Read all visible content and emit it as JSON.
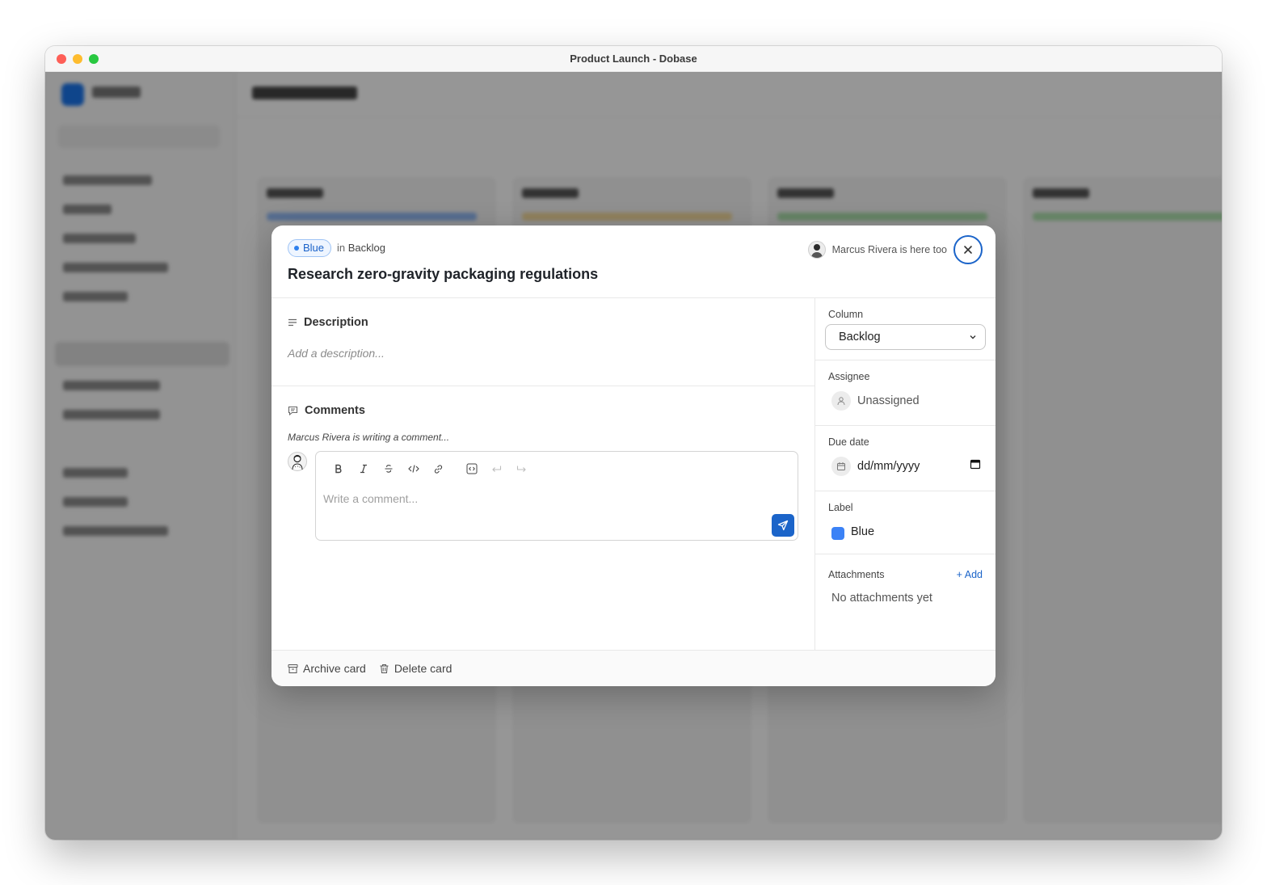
{
  "window": {
    "title": "Product Launch - Dobase"
  },
  "card": {
    "label_badge": "Blue",
    "in_prefix": "in",
    "column_name": "Backlog",
    "title": "Research zero-gravity packaging regulations",
    "presence": "Marcus Rivera is here too"
  },
  "description": {
    "heading": "Description",
    "placeholder": "Add a description..."
  },
  "comments": {
    "heading": "Comments",
    "typing_indicator": "Marcus Rivera is writing a comment...",
    "placeholder": "Write a comment...",
    "toolbar": [
      "bold-icon",
      "italic-icon",
      "strikethrough-icon",
      "code-icon",
      "link-icon",
      "code-block-icon",
      "undo-icon",
      "redo-icon"
    ]
  },
  "sidebar_fields": {
    "column_label": "Column",
    "column_value": "Backlog",
    "assignee_label": "Assignee",
    "assignee_value": "Unassigned",
    "due_label": "Due date",
    "due_value": "dd/mm/yyyy",
    "label_label": "Label",
    "label_value": "Blue",
    "label_color": "#3b82f6",
    "attachments_label": "Attachments",
    "attachments_add": "+ Add",
    "attachments_empty": "No attachments yet"
  },
  "footer": {
    "archive": "Archive card",
    "delete": "Delete card"
  },
  "colors": {
    "accent": "#1b64c9",
    "badge_bg": "#eef5ff"
  }
}
